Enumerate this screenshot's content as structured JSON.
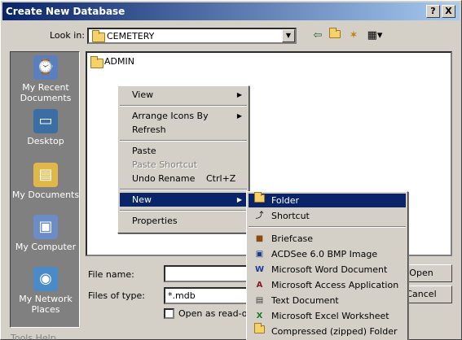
{
  "window": {
    "title": "Create New Database",
    "help_button": "?",
    "close_button": "X"
  },
  "toolbar": {
    "look_in_label": "Look in:",
    "look_in_value": "CEMETERY"
  },
  "places": [
    {
      "label": "My Recent Documents",
      "icon": "recent-documents-icon"
    },
    {
      "label": "Desktop",
      "icon": "desktop-icon"
    },
    {
      "label": "My Documents",
      "icon": "my-documents-icon"
    },
    {
      "label": "My Computer",
      "icon": "my-computer-icon"
    },
    {
      "label": "My Network Places",
      "icon": "network-places-icon"
    }
  ],
  "files": [
    {
      "name": "ADMIN",
      "icon": "folder-icon"
    }
  ],
  "form": {
    "file_name_label": "File name:",
    "file_name_value": "",
    "files_of_type_label": "Files of type:",
    "files_of_type_value": "*.mdb",
    "open_button": "Open",
    "cancel_button": "Cancel",
    "read_only_label": "Open as read-onl",
    "menu_bits": "Tools    Help"
  },
  "context_menu": {
    "view": "View",
    "arrange_icons_by": "Arrange Icons By",
    "refresh": "Refresh",
    "paste": "Paste",
    "paste_shortcut": "Paste Shortcut",
    "undo_rename": "Undo Rename",
    "undo_rename_shortcut": "Ctrl+Z",
    "new": "New",
    "properties": "Properties"
  },
  "new_submenu": {
    "folder": "Folder",
    "shortcut": "Shortcut",
    "briefcase": "Briefcase",
    "acdsee_bmp": "ACDSee 6.0 BMP Image",
    "word_doc": "Microsoft Word Document",
    "access_app": "Microsoft Access Application",
    "text_doc": "Text Document",
    "excel_ws": "Microsoft Excel Worksheet",
    "compressed_folder": "Compressed (zipped) Folder"
  },
  "colors": {
    "selection": "#0a246a",
    "face": "#d4d0c8"
  }
}
